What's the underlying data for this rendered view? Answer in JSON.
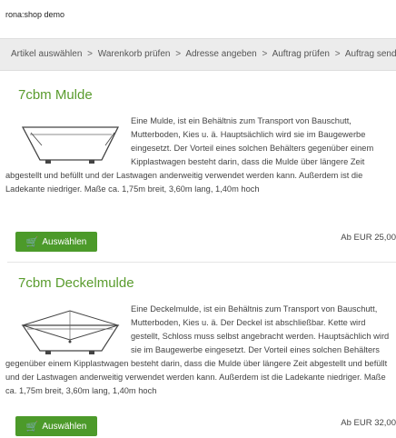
{
  "header": {
    "site_title": "rona:shop demo"
  },
  "breadcrumb": {
    "steps": [
      "Artikel auswählen",
      "Warenkorb prüfen",
      "Adresse angeben",
      "Auftrag prüfen",
      "Auftrag senden"
    ],
    "separator": ">"
  },
  "products": [
    {
      "title": "7cbm Mulde",
      "description": "Eine Mulde, ist ein Behältnis zum Transport von Bauschutt, Mutterboden, Kies u. ä. Hauptsächlich wird sie im Baugewerbe eingesetzt. Der Vorteil eines solchen Behälters gegenüber einem Kipplastwagen besteht darin, dass die Mulde über längere Zeit abgestellt und befüllt und der Lastwagen anderweitig verwendet werden kann. Außerdem ist die Ladekante niedriger. Maße ca. 1,75m breit, 3,60m lang, 1,40m hoch",
      "button_label": "Auswählen",
      "price": "Ab EUR 25,00"
    },
    {
      "title": "7cbm Deckelmulde",
      "description": "Eine Deckelmulde, ist ein Behältnis zum Transport von Bauschutt, Mutterboden, Kies u. ä. Der Deckel ist abschließbar. Kette wird gestellt, Schloss muss selbst angebracht werden. Hauptsächlich wird sie im Baugewerbe eingesetzt. Der Vorteil eines solchen Behälters gegenüber einem Kipplastwagen besteht darin, dass die Mulde über längere Zeit abgestellt und befüllt und der Lastwagen anderweitig verwendet werden kann. Außerdem ist die Ladekante niedriger. Maße ca. 1,75m breit, 3,60m lang, 1,40m hoch",
      "button_label": "Auswählen",
      "price": "Ab EUR 32,00"
    }
  ],
  "icons": {
    "cart": "shopping-cart-icon"
  },
  "colors": {
    "accent": "#5a9c2e",
    "button": "#4c9a2a",
    "breadcrumb_bg": "#ececec"
  }
}
